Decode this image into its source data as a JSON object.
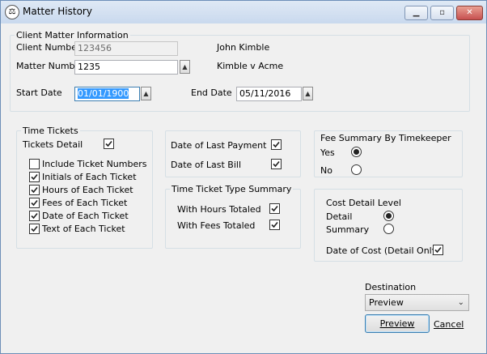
{
  "window": {
    "title": "Matter History",
    "controls": {
      "minimize": "▁",
      "maximize": "▫",
      "close": "✕"
    }
  },
  "client_matter": {
    "legend": "Client Matter Information",
    "client_number_label": "Client Number",
    "client_number_value": "123456",
    "client_name": "John Kimble",
    "matter_number_label": "Matter Number",
    "matter_number_value": "1235",
    "matter_name": "Kimble v Acme",
    "start_date_label": "Start Date",
    "start_date_value": "01/01/1900",
    "end_date_label": "End Date",
    "end_date_value": "05/11/2016"
  },
  "time_tickets": {
    "legend": "Time Tickets",
    "tickets_detail_label": "Tickets Detail",
    "tickets_detail_checked": true,
    "options": [
      {
        "label": "Include Ticket Numbers",
        "checked": false
      },
      {
        "label": "Initials of Each Ticket",
        "checked": true
      },
      {
        "label": "Hours of Each Ticket",
        "checked": true
      },
      {
        "label": "Fees of Each Ticket",
        "checked": true
      },
      {
        "label": "Date of Each Ticket",
        "checked": true
      },
      {
        "label": "Text of Each Ticket",
        "checked": true
      }
    ]
  },
  "payments": {
    "date_last_payment_label": "Date of Last Payment",
    "date_last_payment_checked": true,
    "date_last_bill_label": "Date of Last Bill",
    "date_last_bill_checked": true
  },
  "type_summary": {
    "legend": "Time Ticket Type Summary",
    "hours_label": "With Hours Totaled",
    "hours_checked": true,
    "fees_label": "With Fees Totaled",
    "fees_checked": true
  },
  "fee_summary": {
    "legend": "Fee Summary By Timekeeper",
    "yes_label": "Yes",
    "no_label": "No",
    "selected": "Yes"
  },
  "cost_detail": {
    "legend": "Cost Detail Level",
    "detail_label": "Detail",
    "summary_label": "Summary",
    "selected": "Detail",
    "date_of_cost_label": "Date of Cost (Detail Only)",
    "date_of_cost_checked": true
  },
  "destination": {
    "label": "Destination",
    "selected": "Preview",
    "preview_button": "Preview",
    "cancel_button": "Cancel"
  }
}
